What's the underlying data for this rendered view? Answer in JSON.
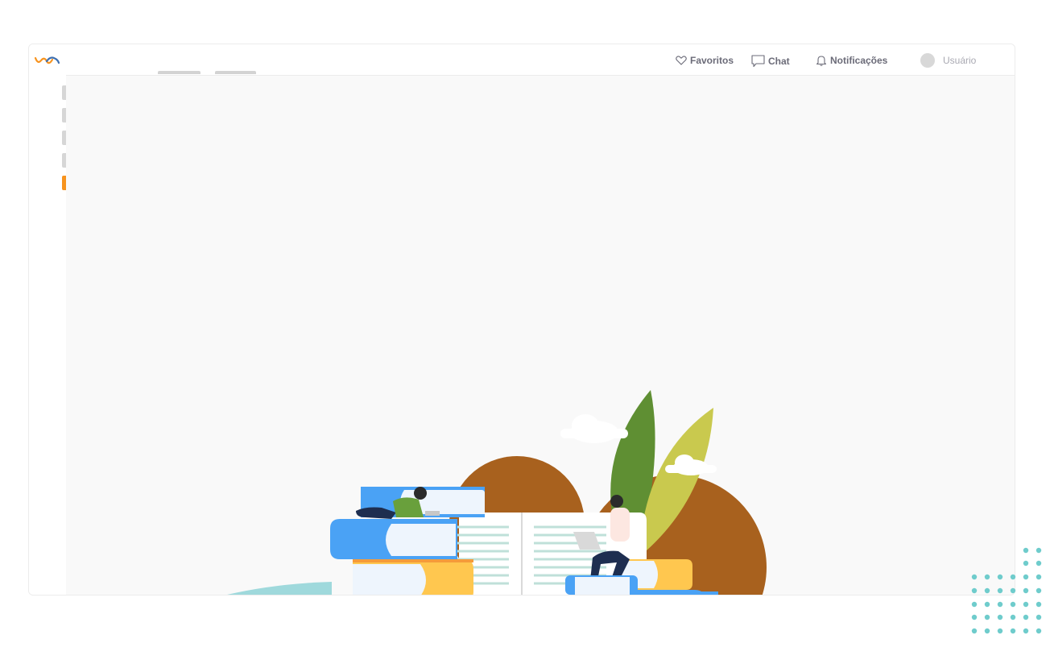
{
  "nav": {
    "favorites_label": "Favoritos",
    "chat_label": "Chat",
    "notifications_label": "Notificações",
    "user_label": "Usuário"
  },
  "sidebar": {
    "items": [
      {
        "icon": "menu-item",
        "active": false
      },
      {
        "icon": "menu-item",
        "active": false
      },
      {
        "icon": "menu-item",
        "active": false
      },
      {
        "icon": "menu-item",
        "active": false
      },
      {
        "icon": "menu-item",
        "active": true
      }
    ]
  },
  "colors": {
    "accent": "#f7931e",
    "dots": "#6fcccc",
    "book_blue": "#4aa2f5",
    "book_yellow": "#ffc74f",
    "leaf_green": "#6b9a3c",
    "ground_brown": "#a8611e"
  },
  "illustration": {
    "name": "people-reading-books",
    "description_icons": [
      "books-stack-icon",
      "open-book-icon",
      "plant-icon",
      "cloud-icon"
    ]
  }
}
